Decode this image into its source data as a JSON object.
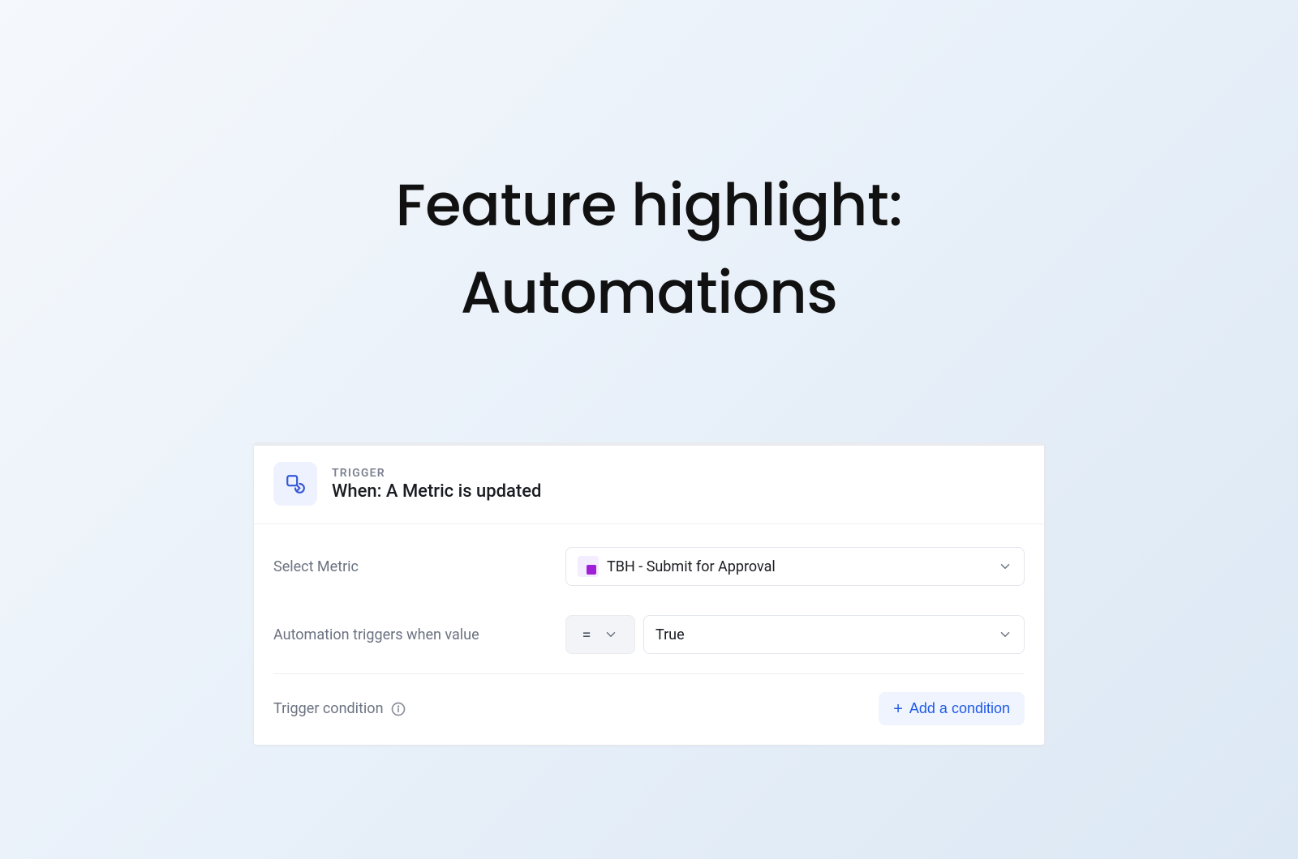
{
  "page": {
    "title": "Feature highlight: Automations"
  },
  "trigger": {
    "eyebrow": "TRIGGER",
    "title": "When: A Metric is updated"
  },
  "form": {
    "metric": {
      "label": "Select Metric",
      "value": "TBH - Submit for Approval"
    },
    "when": {
      "label": "Automation triggers when value",
      "operator": "=",
      "value": "True"
    },
    "condition": {
      "label": "Trigger condition",
      "button": "Add a condition"
    }
  }
}
